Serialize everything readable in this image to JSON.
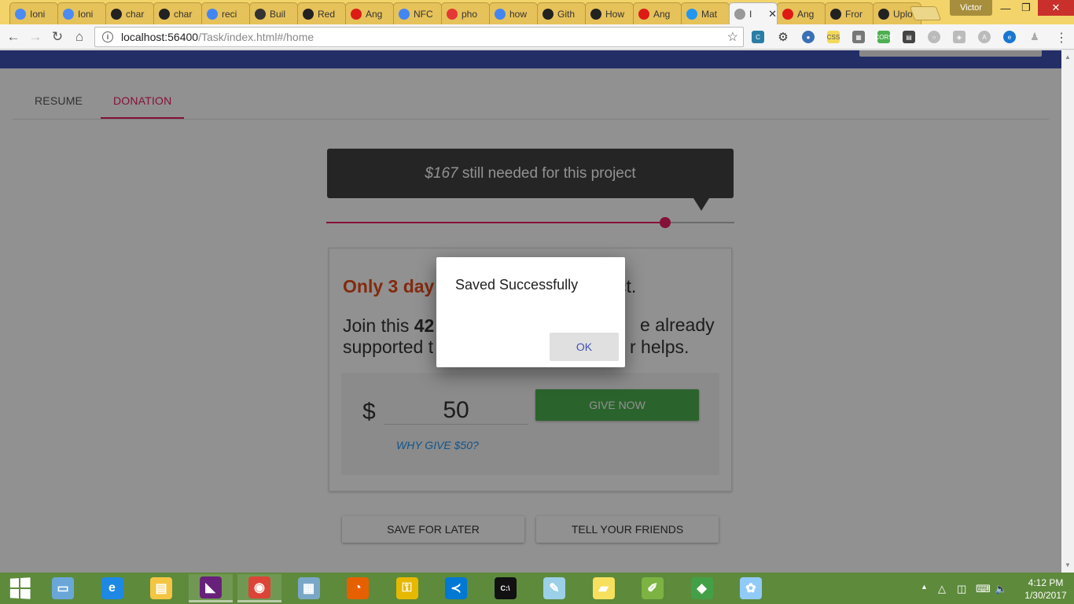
{
  "browser": {
    "tabs": [
      {
        "title": "Ioni",
        "icon": "ionic-icon",
        "color": "#4a8bf5"
      },
      {
        "title": "Ioni",
        "icon": "ionic-icon",
        "color": "#4a8bf5"
      },
      {
        "title": "char",
        "icon": "github-icon",
        "color": "#222222"
      },
      {
        "title": "char",
        "icon": "github-icon",
        "color": "#222222"
      },
      {
        "title": "reci",
        "icon": "google-icon",
        "color": "#4285f4"
      },
      {
        "title": "Buil",
        "icon": "office-icon",
        "color": "#333333"
      },
      {
        "title": "Red",
        "icon": "github-icon",
        "color": "#222222"
      },
      {
        "title": "Ang",
        "icon": "angular-icon",
        "color": "#dd1b16"
      },
      {
        "title": "NFC",
        "icon": "google-icon",
        "color": "#4285f4"
      },
      {
        "title": "pho",
        "icon": "page-icon",
        "color": "#e53935"
      },
      {
        "title": "how",
        "icon": "google-icon",
        "color": "#4285f4"
      },
      {
        "title": "Gith",
        "icon": "github-icon",
        "color": "#222222"
      },
      {
        "title": "How",
        "icon": "github-icon",
        "color": "#222222"
      },
      {
        "title": "Ang",
        "icon": "angular-icon",
        "color": "#dd1b16"
      },
      {
        "title": "Mat",
        "icon": "material-icon",
        "color": "#2196f3"
      },
      {
        "title": "I",
        "icon": "blank-page-icon",
        "color": "#999999",
        "active": true
      },
      {
        "title": "Ang",
        "icon": "angular-icon",
        "color": "#dd1b16"
      },
      {
        "title": "Fror",
        "icon": "github-icon",
        "color": "#222222"
      },
      {
        "title": "Uplo",
        "icon": "github-icon",
        "color": "#222222"
      }
    ],
    "profile_name": "Victor",
    "url_host": "localhost:56400",
    "url_path": "/Task/index.html#/home"
  },
  "page": {
    "tabs": {
      "resume": "RESUME",
      "donation": "DONATION"
    },
    "tooltip": {
      "amount": "$167",
      "text": " still needed for this project"
    },
    "progress_fraction": 0.83,
    "card": {
      "deadline_highlight": "Only 3 day",
      "deadline_rest": "ct.",
      "join_prefix": "Join this ",
      "join_bold": "42",
      "join_right1": "e already",
      "join_left2": "supported t",
      "join_right2": "r helps.",
      "currency": "$",
      "amount": "50",
      "why_link": "WHY GIVE $50?",
      "give_button": "GIVE NOW"
    },
    "save_later": "SAVE FOR LATER",
    "tell_friends": "TELL YOUR FRIENDS"
  },
  "dialog": {
    "message": "Saved Successfully",
    "ok": "OK"
  },
  "taskbar": {
    "apps": [
      {
        "name": "remote-desktop-icon",
        "color": "#6aa7d8",
        "glyph": "▭"
      },
      {
        "name": "internet-explorer-icon",
        "color": "#1e88e5",
        "glyph": "e"
      },
      {
        "name": "file-explorer-icon",
        "color": "#f4c542",
        "glyph": "▤"
      },
      {
        "name": "visual-studio-icon",
        "color": "#68217a",
        "glyph": "◣",
        "pinned": true
      },
      {
        "name": "chrome-icon",
        "color": "#db4437",
        "glyph": "◉",
        "pinned": true
      },
      {
        "name": "calculator-icon",
        "color": "#7aa7c7",
        "glyph": "▦"
      },
      {
        "name": "firefox-icon",
        "color": "#e66000",
        "glyph": "◔"
      },
      {
        "name": "user-lock-icon",
        "color": "#e6b800",
        "glyph": "⚿"
      },
      {
        "name": "vscode-icon",
        "color": "#0078d4",
        "glyph": "≺"
      },
      {
        "name": "command-prompt-icon",
        "color": "#111111",
        "glyph": "C:\\"
      },
      {
        "name": "notepad-icon",
        "color": "#9ccfe8",
        "glyph": "✎"
      },
      {
        "name": "sticky-notes-icon",
        "color": "#f6e05e",
        "glyph": "▰"
      },
      {
        "name": "notepad-plus-icon",
        "color": "#7cb342",
        "glyph": "✐"
      },
      {
        "name": "git-icon",
        "color": "#43a047",
        "glyph": "◆"
      },
      {
        "name": "paint-icon",
        "color": "#90caf9",
        "glyph": "✿"
      }
    ],
    "time": "4:12 PM",
    "date": "1/30/2017"
  }
}
